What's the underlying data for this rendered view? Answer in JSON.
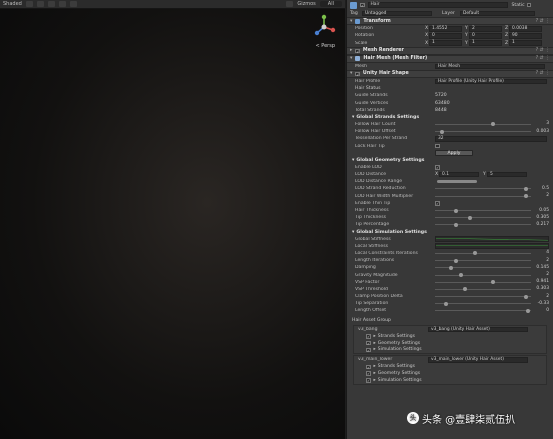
{
  "toolbar": {
    "shading": "Shaded",
    "gizmos": "Gizmos",
    "search": "All"
  },
  "viewport": {
    "persp_label": "< Persp"
  },
  "inspector": {
    "object": {
      "name": "Hair",
      "static": "Static",
      "tag_label": "Tag",
      "tag_value": "Untagged",
      "layer_label": "Layer",
      "layer_value": "Default"
    },
    "transform": {
      "title": "Transform",
      "position": {
        "label": "Position",
        "x": "1.4552",
        "y": "2",
        "z": "0.0038"
      },
      "rotation": {
        "label": "Rotation",
        "x": "0",
        "y": "0",
        "z": "90"
      },
      "scale": {
        "label": "Scale",
        "x": "1",
        "y": "1",
        "z": "1"
      }
    },
    "mesh_renderer": {
      "title": "Mesh Renderer"
    },
    "mesh_filter": {
      "title": "Hair Mesh (Mesh Filter)",
      "mesh_label": "Mesh",
      "mesh_value": "Hair Mesh"
    },
    "hair_shape": {
      "title": "Unity Hair Shape",
      "hair_profile_label": "Hair Profile",
      "hair_profile_value": "Hair Profile (Unity Hair Profile)",
      "hair_status": "Hair Status",
      "status": [
        {
          "label": "Guide Strands",
          "value": "5720"
        },
        {
          "label": "Guide Vertices",
          "value": "63480"
        },
        {
          "label": "Total Strands",
          "value": "8448"
        }
      ],
      "global_strands": {
        "title": "Global Strands Settings",
        "rows": [
          {
            "label": "Follow Hair Count",
            "value": "3",
            "pos": 0.6
          },
          {
            "label": "Follow Hair Offset",
            "value": "0.003",
            "pos": 0.05
          }
        ],
        "tessellation_label": "Tessellation Per Strand",
        "tessellation_value": "32",
        "lock_hair_tip": "Lock Hair Tip",
        "apply": "Apply"
      },
      "global_geometry": {
        "title": "Global Geometry Settings",
        "enable_lod": "Enable LOD",
        "lod_distance_label": "LOD Distance",
        "lod_distance_x": "0.1",
        "lod_distance_y": "5",
        "lod_distance_range": "LOD Distance Range",
        "rows": [
          {
            "label": "LOD Strand Reduction",
            "value": "0.5",
            "pos": 0.95
          },
          {
            "label": "LOD Hair Width Multiplier",
            "value": "2",
            "pos": 0.95
          }
        ],
        "enable_thin_tip": "Enable Thin Tip",
        "rows2": [
          {
            "label": "Hair Thickness",
            "value": "0.05",
            "pos": 0.2
          },
          {
            "label": "Tip Thickness",
            "value": "0.305",
            "pos": 0.35
          },
          {
            "label": "Tip Percentage",
            "value": "0.217",
            "pos": 0.2
          }
        ]
      },
      "global_simulation": {
        "title": "Global Simulation Settings",
        "global_stiffness": "Global Stiffness",
        "local_stiffness": "Local Stiffness",
        "rows": [
          {
            "label": "Local Constraints Iterations",
            "value": "4",
            "pos": 0.4
          },
          {
            "label": "Length Iterations",
            "value": "2",
            "pos": 0.2
          },
          {
            "label": "Damping",
            "value": "0.145",
            "pos": 0.15
          },
          {
            "label": "Gravity Magnitude",
            "value": "2",
            "pos": 0.25
          },
          {
            "label": "VSP Factor",
            "value": "0.941",
            "pos": 0.6
          },
          {
            "label": "VSP Threshold",
            "value": "0.303",
            "pos": 0.3
          },
          {
            "label": "Clamp Position Delta",
            "value": "2",
            "pos": 0.95
          },
          {
            "label": "Tip Separation",
            "value": "-0.33",
            "pos": 0.1
          },
          {
            "label": "Length Offset",
            "value": "0",
            "pos": 0.97
          }
        ]
      },
      "hair_asset_group": {
        "title": "Hair Asset Group",
        "groups": [
          {
            "name": "v3_bang",
            "asset": "v3_bang (Unity Hair Asset)",
            "items": [
              "Strands Settings",
              "Geometry Settings",
              "Simulation Settings"
            ]
          },
          {
            "name": "v3_main_lower",
            "asset": "v3_main_lower (Unity Hair Asset)",
            "items": [
              "Strands Settings",
              "Geometry Settings",
              "Simulation Settings"
            ]
          }
        ]
      }
    }
  },
  "watermark": {
    "logo_text": "头",
    "text": "头条 @壹肆柒贰伍扒"
  },
  "colors": {
    "accent": "#6b9bd1",
    "curve_green": "#3fb43f",
    "panel": "#383838",
    "viewport_bg": "#0d0d0d"
  }
}
